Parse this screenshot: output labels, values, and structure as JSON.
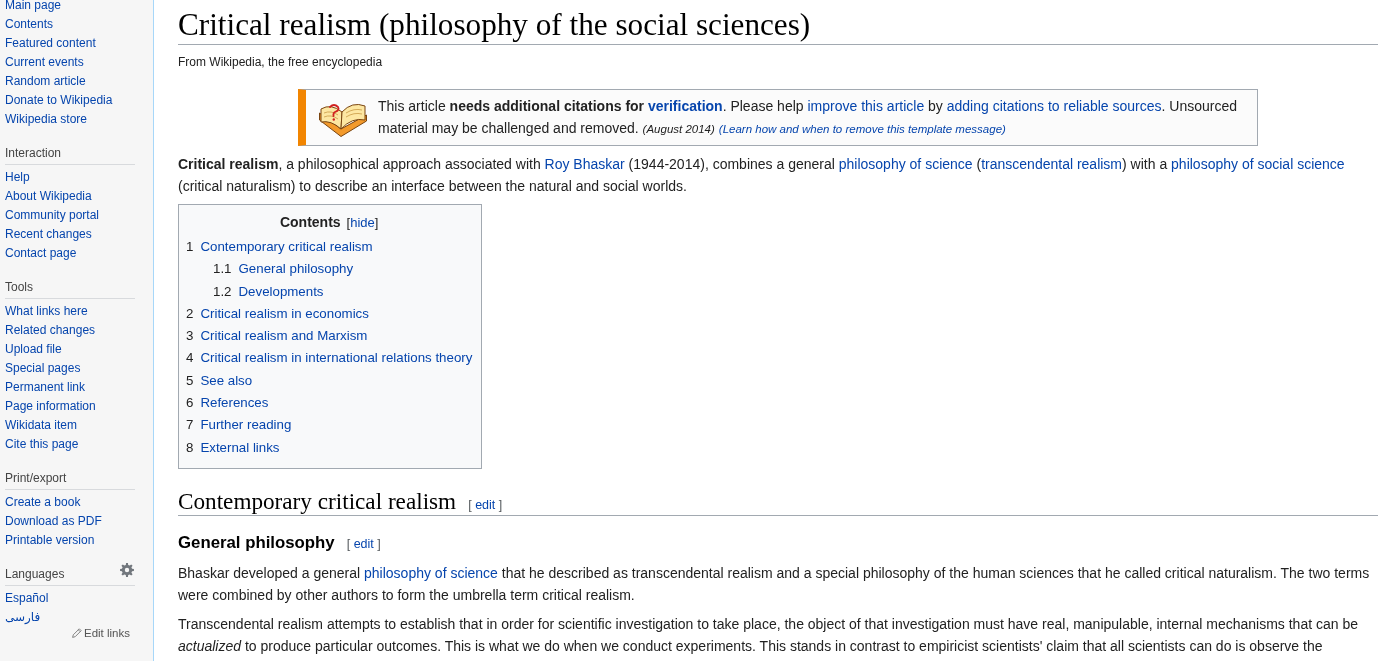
{
  "sidebar": {
    "navigation": [
      "Main page",
      "Contents",
      "Featured content",
      "Current events",
      "Random article",
      "Donate to Wikipedia",
      "Wikipedia store"
    ],
    "portals": [
      {
        "kind": "links",
        "heading": "Interaction",
        "items": [
          "Help",
          "About Wikipedia",
          "Community portal",
          "Recent changes",
          "Contact page"
        ]
      },
      {
        "kind": "links",
        "heading": "Tools",
        "items": [
          "What links here",
          "Related changes",
          "Upload file",
          "Special pages",
          "Permanent link",
          "Page information",
          "Wikidata item",
          "Cite this page"
        ]
      },
      {
        "kind": "links",
        "heading": "Print/export",
        "items": [
          "Create a book",
          "Download as PDF",
          "Printable version"
        ]
      },
      {
        "kind": "languages",
        "heading": "Languages",
        "items": [
          "Español",
          "فارسی"
        ],
        "edit_links": "Edit links"
      }
    ]
  },
  "article": {
    "title": "Critical realism (philosophy of the social sciences)",
    "tagline": "From Wikipedia, the free encyclopedia",
    "notice": {
      "segments": [
        {
          "kind": "text",
          "text": "This article **needs additional citations for** "
        },
        {
          "kind": "strong-link",
          "text": "verification"
        },
        {
          "kind": "text",
          "text": ". Please help "
        },
        {
          "kind": "link",
          "text": "improve this article"
        },
        {
          "kind": "text",
          "text": " by "
        },
        {
          "kind": "link",
          "text": "adding citations to reliable sources"
        },
        {
          "kind": "text",
          "text": ". Unsourced material may be challenged and removed. "
        },
        {
          "kind": "note",
          "text": "(August 2014)"
        },
        {
          "kind": "note-link",
          "text": "(Learn how and when to remove this template message)"
        }
      ]
    },
    "lead": [
      {
        "kind": "text",
        "text": "**Critical realism**, a philosophical approach associated with "
      },
      {
        "kind": "link",
        "text": "Roy Bhaskar"
      },
      {
        "kind": "text",
        "text": " (1944-2014), combines a general "
      },
      {
        "kind": "link",
        "text": "philosophy of science"
      },
      {
        "kind": "text",
        "text": " ("
      },
      {
        "kind": "link",
        "text": "transcendental realism"
      },
      {
        "kind": "text",
        "text": ") with a "
      },
      {
        "kind": "link",
        "text": "philosophy of social science"
      },
      {
        "kind": "text",
        "text": " (critical naturalism) to describe an interface between the natural and social worlds."
      }
    ],
    "toc": {
      "title": "Contents",
      "toggle": {
        "open": "[",
        "label": "hide",
        "close": "]"
      },
      "entries": [
        {
          "number": "1",
          "text": "Contemporary critical realism",
          "children": [
            {
              "number": "1.1",
              "text": "General philosophy"
            },
            {
              "number": "1.2",
              "text": "Developments"
            }
          ]
        },
        {
          "number": "2",
          "text": "Critical realism in economics"
        },
        {
          "number": "3",
          "text": "Critical realism and Marxism"
        },
        {
          "number": "4",
          "text": "Critical realism in international relations theory"
        },
        {
          "number": "5",
          "text": "See also"
        },
        {
          "number": "6",
          "text": "References"
        },
        {
          "number": "7",
          "text": "Further reading"
        },
        {
          "number": "8",
          "text": "External links"
        }
      ]
    },
    "sections": [
      {
        "kind": "heading2",
        "title": "Contemporary critical realism",
        "edit": {
          "open": "[",
          "label": "edit",
          "close": "]"
        }
      },
      {
        "kind": "heading3",
        "title": "General philosophy",
        "edit": {
          "open": "[",
          "label": "edit",
          "close": "]"
        }
      },
      {
        "kind": "paragraph",
        "segments": [
          {
            "kind": "text",
            "text": "Bhaskar developed a general "
          },
          {
            "kind": "link",
            "text": "philosophy of science"
          },
          {
            "kind": "text",
            "text": " that he described as transcendental realism and a special philosophy of the human sciences that he called critical naturalism. The two terms were combined by other authors to form the umbrella term critical realism."
          }
        ]
      },
      {
        "kind": "paragraph",
        "segments": [
          {
            "kind": "text",
            "text": "Transcendental realism attempts to establish that in order for scientific investigation to take place, the object of that investigation must have real, manipulable, internal mechanisms that can be *actualized* to produce particular outcomes. This is what we do when we conduct experiments. This stands in contrast to empiricist scientists' claim that all scientists can do is observe the"
          }
        ]
      }
    ]
  }
}
